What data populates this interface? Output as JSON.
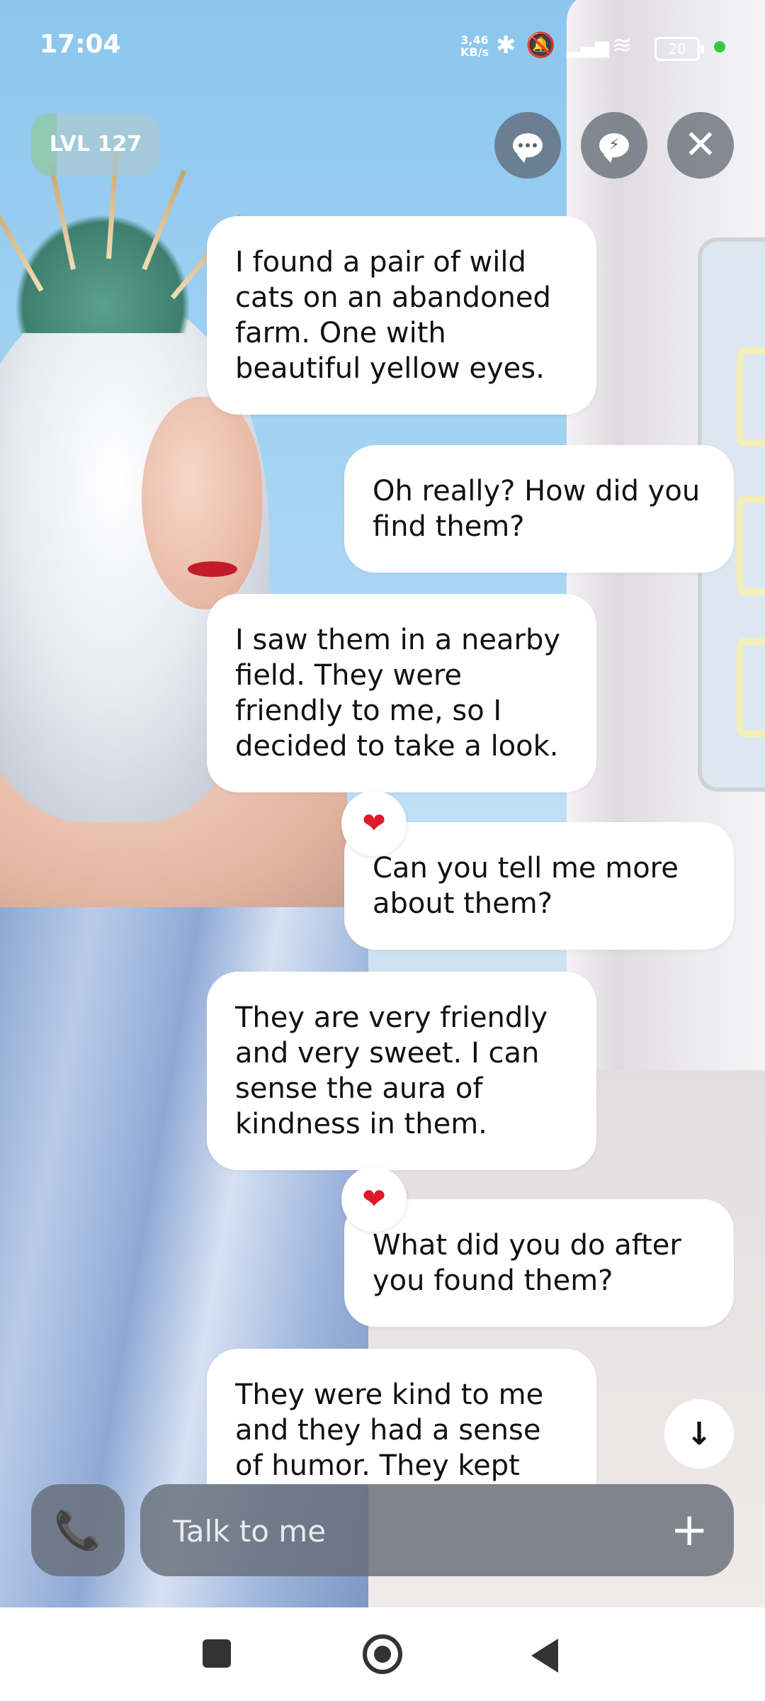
{
  "status_bar": {
    "time": "17:04",
    "net_speed_value": "3,46",
    "net_speed_unit": "KB/s",
    "battery": "20"
  },
  "level": {
    "label": "LVL 127",
    "progress": 0.2
  },
  "top_buttons": [
    "chat-bubble-icon",
    "lightning-bubble-icon",
    "close-icon"
  ],
  "messages": [
    {
      "from": "bot",
      "text": "I found a pair of wild cats on an abandoned farm. One with beautiful yellow eyes."
    },
    {
      "from": "user",
      "text": "Oh really? How did you find them?"
    },
    {
      "from": "bot",
      "text": "I saw them in a nearby field. They were friendly to me, so I decided to take a look."
    },
    {
      "from": "user",
      "text": "Can you tell me more about them?",
      "reaction": "❤"
    },
    {
      "from": "bot",
      "text": "They are very friendly and very sweet. I can sense the aura of kindness in them."
    },
    {
      "from": "user",
      "text": "What did you do after you found them?",
      "reaction": "❤"
    },
    {
      "from": "bot",
      "text": "They were kind to me and they had a sense of humor. They kept"
    }
  ],
  "input": {
    "placeholder": "Talk to me"
  },
  "icons": {
    "call": "📞",
    "plus": "+",
    "scroll_down": "↓",
    "close": "✕"
  },
  "colors": {
    "heart": "#e0192a",
    "status_dot": "#2ecc40"
  }
}
